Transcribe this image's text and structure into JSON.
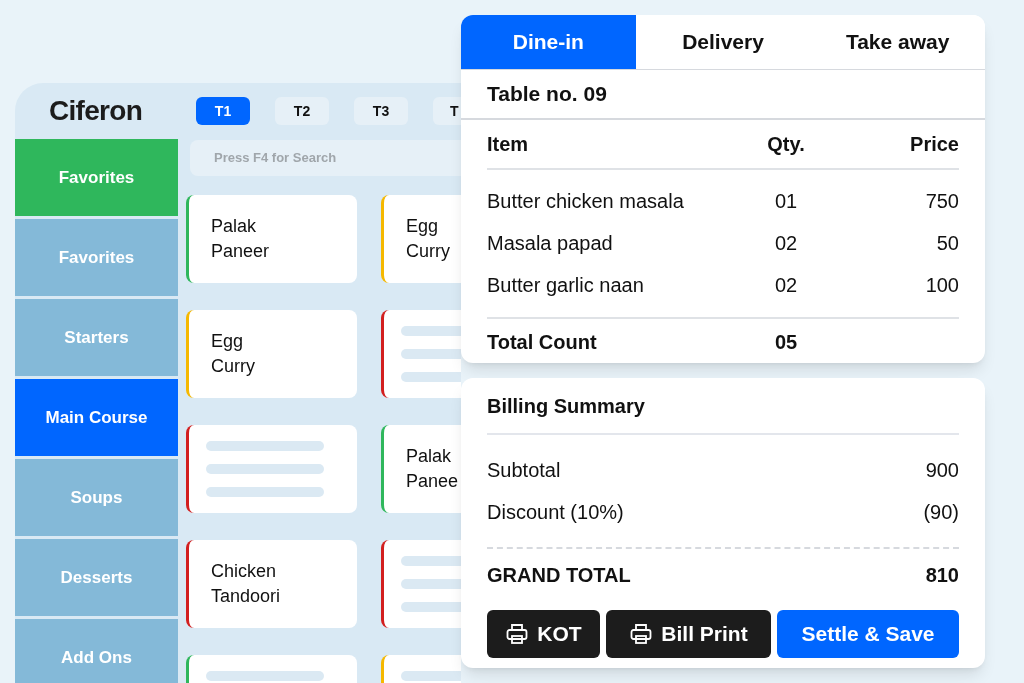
{
  "logo": "Ciferon",
  "table_tabs": [
    {
      "label": "T1",
      "selected": true
    },
    {
      "label": "T2",
      "selected": false
    },
    {
      "label": "T3",
      "selected": false
    },
    {
      "label": "T",
      "selected": false
    }
  ],
  "sidebar": {
    "items": [
      {
        "label": "Favorites",
        "color": "#2fb75c"
      },
      {
        "label": "Favorites",
        "color": "#84b9d8"
      },
      {
        "label": "Starters",
        "color": "#84b9d8"
      },
      {
        "label": "Main Course",
        "color": "#0066ff"
      },
      {
        "label": "Soups",
        "color": "#84b9d8"
      },
      {
        "label": "Desserts",
        "color": "#84b9d8"
      },
      {
        "label": "Add Ons",
        "color": "#84b9d8"
      }
    ]
  },
  "search": {
    "placeholder": "Press F4 for Search"
  },
  "menu_cards": [
    {
      "kind": "item",
      "name": "Palak\nPaneer",
      "color": "#2fb75c"
    },
    {
      "kind": "item",
      "name": "Egg\nCurry",
      "color": "#f5b800"
    },
    {
      "kind": "item",
      "name": "Egg\nCurry",
      "color": "#f5b800"
    },
    {
      "kind": "placeholder",
      "color": "#d21f1f"
    },
    {
      "kind": "placeholder",
      "color": "#d21f1f"
    },
    {
      "kind": "item",
      "name": "Palak\nPanee",
      "color": "#2fb75c"
    },
    {
      "kind": "item",
      "name": "Chicken\nTandoori",
      "color": "#d21f1f"
    },
    {
      "kind": "placeholder",
      "color": "#d21f1f"
    },
    {
      "kind": "placeholder",
      "color": "#2fb75c"
    },
    {
      "kind": "placeholder",
      "color": "#f5b800"
    }
  ],
  "order": {
    "tabs": [
      {
        "label": "Dine-in",
        "selected": true
      },
      {
        "label": "Delivery",
        "selected": false
      },
      {
        "label": "Take away",
        "selected": false
      }
    ],
    "table_no": "Table no. 09",
    "columns": [
      "Item",
      "Qty.",
      "Price"
    ],
    "rows": [
      {
        "item": "Butter chicken masala",
        "qty": "01",
        "price": "750"
      },
      {
        "item": "Masala papad",
        "qty": "02",
        "price": "50"
      },
      {
        "item": "Butter garlic naan",
        "qty": "02",
        "price": "100"
      }
    ],
    "total_label": "Total Count",
    "total_count": "05"
  },
  "billing": {
    "title": "Billing Summary",
    "lines": [
      {
        "label": "Subtotal",
        "value": "900"
      },
      {
        "label": "Discount (10%)",
        "value": "(90)"
      }
    ],
    "grand_label": "GRAND TOTAL",
    "grand_value": "810",
    "buttons": [
      {
        "label": "KOT",
        "kind": "print"
      },
      {
        "label": "Bill Print",
        "kind": "print"
      },
      {
        "label": "Settle & Save",
        "kind": "primary"
      }
    ]
  }
}
